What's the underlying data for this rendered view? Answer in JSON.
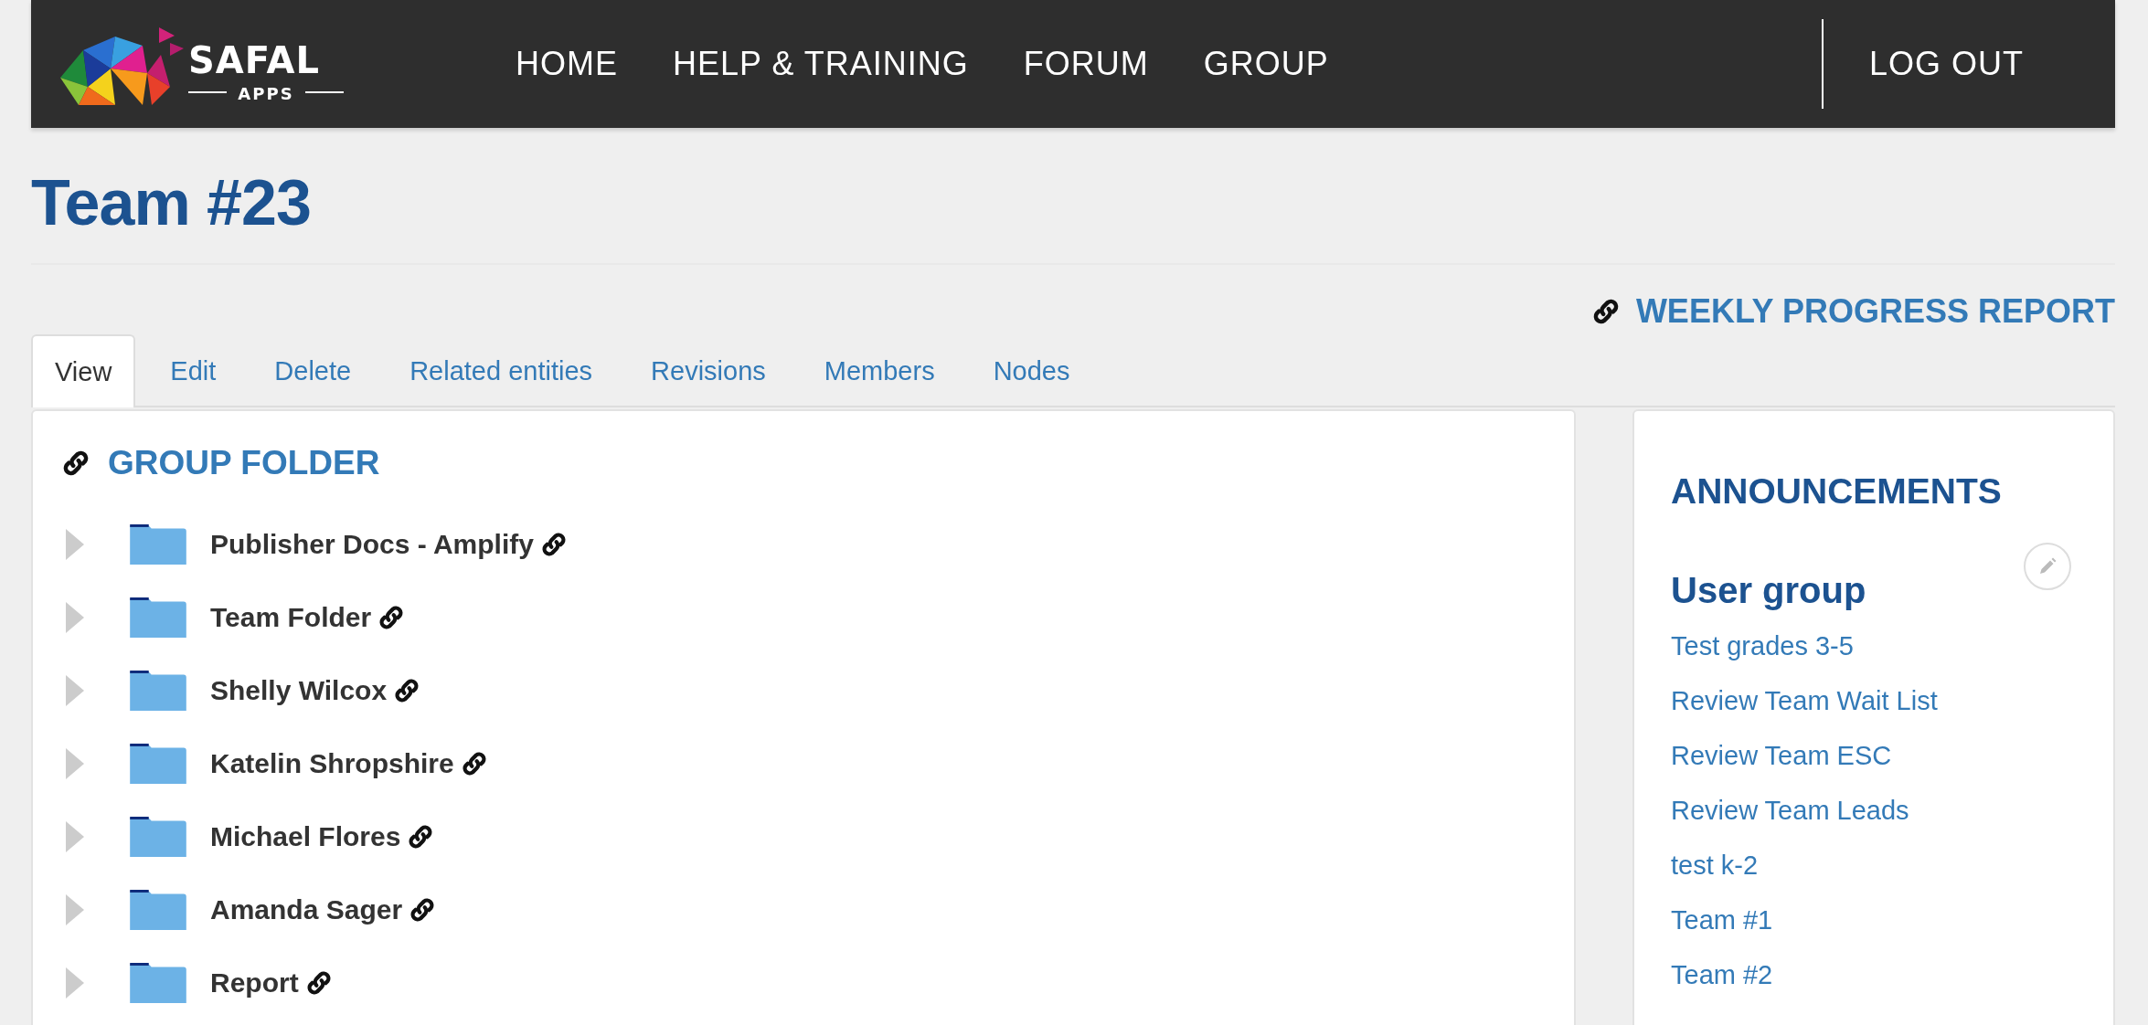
{
  "header": {
    "logo": {
      "name": "SAFAL",
      "tagline": "APPS"
    },
    "nav": [
      {
        "label": "HOME"
      },
      {
        "label": "HELP & TRAINING"
      },
      {
        "label": "FORUM"
      },
      {
        "label": "GROUP"
      }
    ],
    "logout": "LOG OUT"
  },
  "page_title": "Team #23",
  "report_link": "WEEKLY PROGRESS REPORT",
  "tabs": [
    {
      "label": "View",
      "selected": true
    },
    {
      "label": "Edit",
      "selected": false
    },
    {
      "label": "Delete",
      "selected": false
    },
    {
      "label": "Related entities",
      "selected": false
    },
    {
      "label": "Revisions",
      "selected": false
    },
    {
      "label": "Members",
      "selected": false
    },
    {
      "label": "Nodes",
      "selected": false
    }
  ],
  "group_folder": {
    "title": "GROUP FOLDER",
    "items": [
      {
        "name": "Publisher Docs - Amplify",
        "expanded": false
      },
      {
        "name": "Team Folder",
        "expanded": false
      },
      {
        "name": "Shelly Wilcox",
        "expanded": false
      },
      {
        "name": "Katelin Shropshire",
        "expanded": false
      },
      {
        "name": "Michael Flores",
        "expanded": false
      },
      {
        "name": "Amanda Sager",
        "expanded": false
      },
      {
        "name": "Report",
        "expanded": false
      }
    ]
  },
  "announcements": {
    "title": "ANNOUNCEMENTS",
    "subtitle": "User group",
    "links": [
      "Test grades 3-5",
      "Review Team Wait List",
      "Review Team ESC",
      "Review Team Leads",
      "test k-2",
      "Team #1",
      "Team #2"
    ]
  }
}
